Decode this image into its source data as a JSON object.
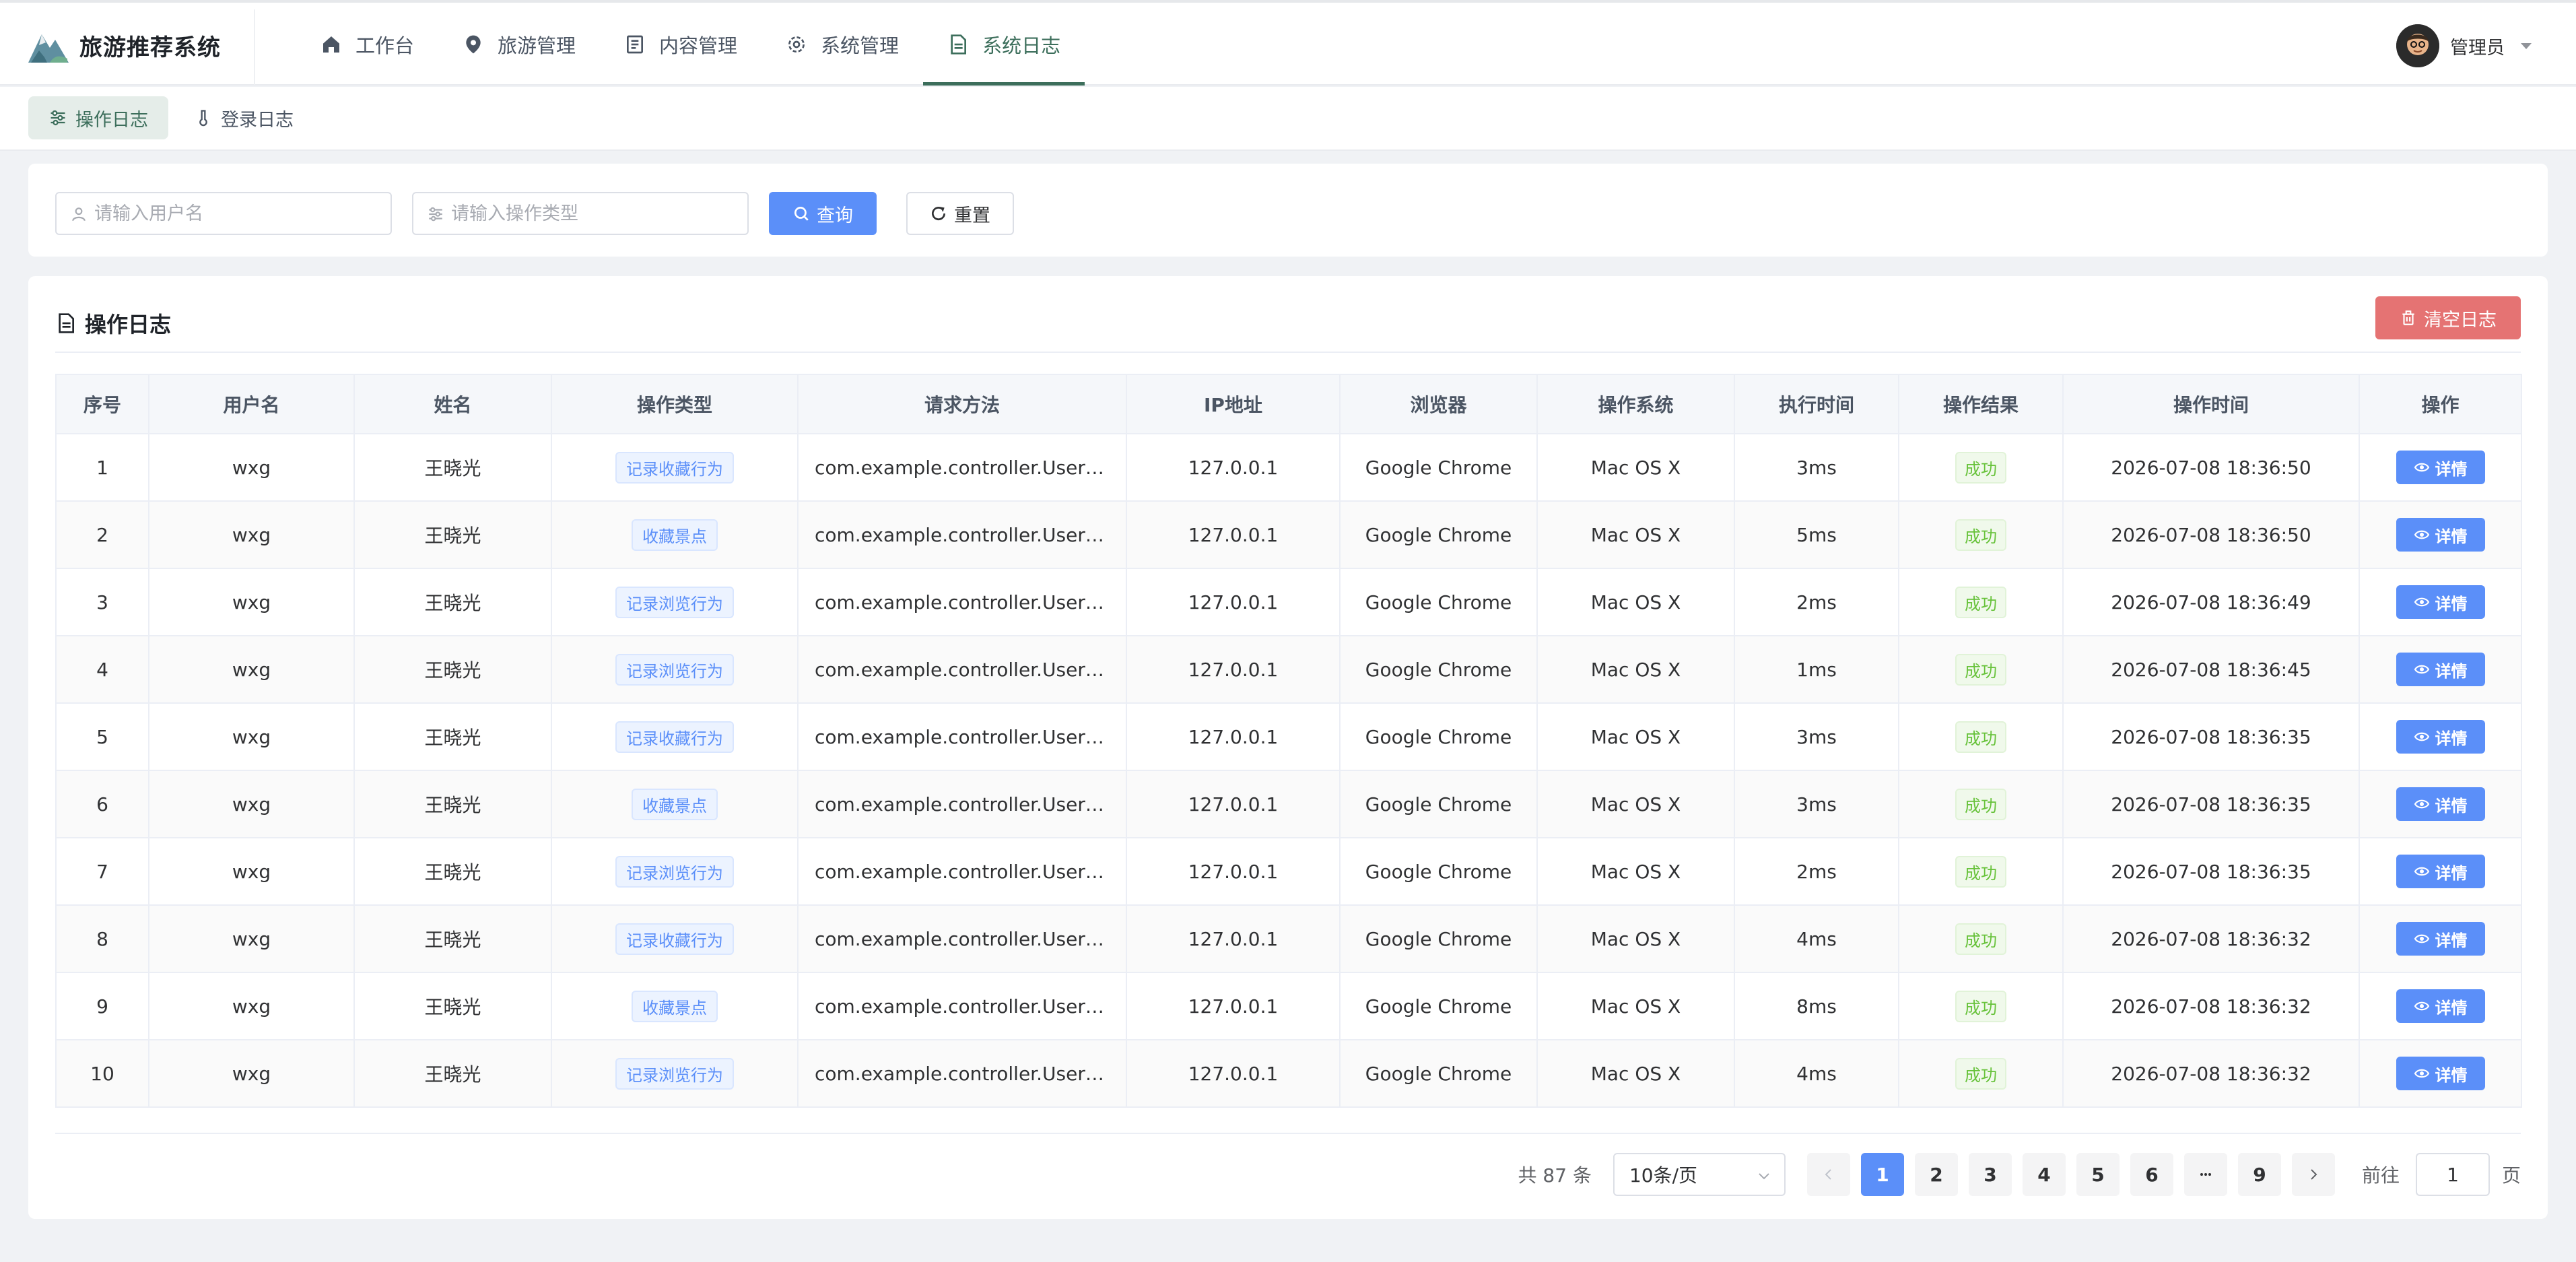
{
  "app": {
    "title": "旅游推荐系统"
  },
  "nav": [
    {
      "label": "工作台",
      "icon": "home-icon"
    },
    {
      "label": "旅游管理",
      "icon": "location-icon"
    },
    {
      "label": "内容管理",
      "icon": "document-icon"
    },
    {
      "label": "系统管理",
      "icon": "gear-icon"
    },
    {
      "label": "系统日志",
      "icon": "log-icon",
      "active": true
    }
  ],
  "user": {
    "name": "管理员"
  },
  "subtabs": [
    {
      "label": "操作日志",
      "icon": "sliders-icon",
      "active": true
    },
    {
      "label": "登录日志",
      "icon": "thermometer-icon"
    }
  ],
  "search": {
    "username_placeholder": "请输入用户名",
    "optype_placeholder": "请输入操作类型",
    "query_label": "查询",
    "reset_label": "重置"
  },
  "table_card": {
    "title": "操作日志",
    "clear_label": "清空日志"
  },
  "table": {
    "columns": [
      "序号",
      "用户名",
      "姓名",
      "操作类型",
      "请求方法",
      "IP地址",
      "浏览器",
      "操作系统",
      "执行时间",
      "操作结果",
      "操作时间",
      "操作"
    ],
    "rows": [
      {
        "no": "1",
        "username": "wxg",
        "name": "王晓光",
        "type": "记录收藏行为",
        "method": "com.example.controller.UserBe...",
        "ip": "127.0.0.1",
        "browser": "Google Chrome",
        "os": "Mac OS X",
        "time": "3ms",
        "result": "成功",
        "optime": "2026-07-08 18:36:50",
        "action": "详情"
      },
      {
        "no": "2",
        "username": "wxg",
        "name": "王晓光",
        "type": "收藏景点",
        "method": "com.example.controller.UserCo...",
        "ip": "127.0.0.1",
        "browser": "Google Chrome",
        "os": "Mac OS X",
        "time": "5ms",
        "result": "成功",
        "optime": "2026-07-08 18:36:50",
        "action": "详情"
      },
      {
        "no": "3",
        "username": "wxg",
        "name": "王晓光",
        "type": "记录浏览行为",
        "method": "com.example.controller.UserBe...",
        "ip": "127.0.0.1",
        "browser": "Google Chrome",
        "os": "Mac OS X",
        "time": "2ms",
        "result": "成功",
        "optime": "2026-07-08 18:36:49",
        "action": "详情"
      },
      {
        "no": "4",
        "username": "wxg",
        "name": "王晓光",
        "type": "记录浏览行为",
        "method": "com.example.controller.UserBe...",
        "ip": "127.0.0.1",
        "browser": "Google Chrome",
        "os": "Mac OS X",
        "time": "1ms",
        "result": "成功",
        "optime": "2026-07-08 18:36:45",
        "action": "详情"
      },
      {
        "no": "5",
        "username": "wxg",
        "name": "王晓光",
        "type": "记录收藏行为",
        "method": "com.example.controller.UserBe...",
        "ip": "127.0.0.1",
        "browser": "Google Chrome",
        "os": "Mac OS X",
        "time": "3ms",
        "result": "成功",
        "optime": "2026-07-08 18:36:35",
        "action": "详情"
      },
      {
        "no": "6",
        "username": "wxg",
        "name": "王晓光",
        "type": "收藏景点",
        "method": "com.example.controller.UserCo...",
        "ip": "127.0.0.1",
        "browser": "Google Chrome",
        "os": "Mac OS X",
        "time": "3ms",
        "result": "成功",
        "optime": "2026-07-08 18:36:35",
        "action": "详情"
      },
      {
        "no": "7",
        "username": "wxg",
        "name": "王晓光",
        "type": "记录浏览行为",
        "method": "com.example.controller.UserBe...",
        "ip": "127.0.0.1",
        "browser": "Google Chrome",
        "os": "Mac OS X",
        "time": "2ms",
        "result": "成功",
        "optime": "2026-07-08 18:36:35",
        "action": "详情"
      },
      {
        "no": "8",
        "username": "wxg",
        "name": "王晓光",
        "type": "记录收藏行为",
        "method": "com.example.controller.UserBe...",
        "ip": "127.0.0.1",
        "browser": "Google Chrome",
        "os": "Mac OS X",
        "time": "4ms",
        "result": "成功",
        "optime": "2026-07-08 18:36:32",
        "action": "详情"
      },
      {
        "no": "9",
        "username": "wxg",
        "name": "王晓光",
        "type": "收藏景点",
        "method": "com.example.controller.UserCo...",
        "ip": "127.0.0.1",
        "browser": "Google Chrome",
        "os": "Mac OS X",
        "time": "8ms",
        "result": "成功",
        "optime": "2026-07-08 18:36:32",
        "action": "详情"
      },
      {
        "no": "10",
        "username": "wxg",
        "name": "王晓光",
        "type": "记录浏览行为",
        "method": "com.example.controller.UserBe...",
        "ip": "127.0.0.1",
        "browser": "Google Chrome",
        "os": "Mac OS X",
        "time": "4ms",
        "result": "成功",
        "optime": "2026-07-08 18:36:32",
        "action": "详情"
      }
    ]
  },
  "pagination": {
    "total": "共 87 条",
    "page_size": "10条/页",
    "pages": [
      "1",
      "2",
      "3",
      "4",
      "5",
      "6",
      "9"
    ],
    "current": "1",
    "goto_prefix": "前往",
    "goto_value": "1",
    "goto_suffix": "页"
  },
  "colors": {
    "primary": "#5b8ff9",
    "brand_green": "#3c6e5b",
    "danger": "#e57373",
    "success": "#67c23a"
  }
}
